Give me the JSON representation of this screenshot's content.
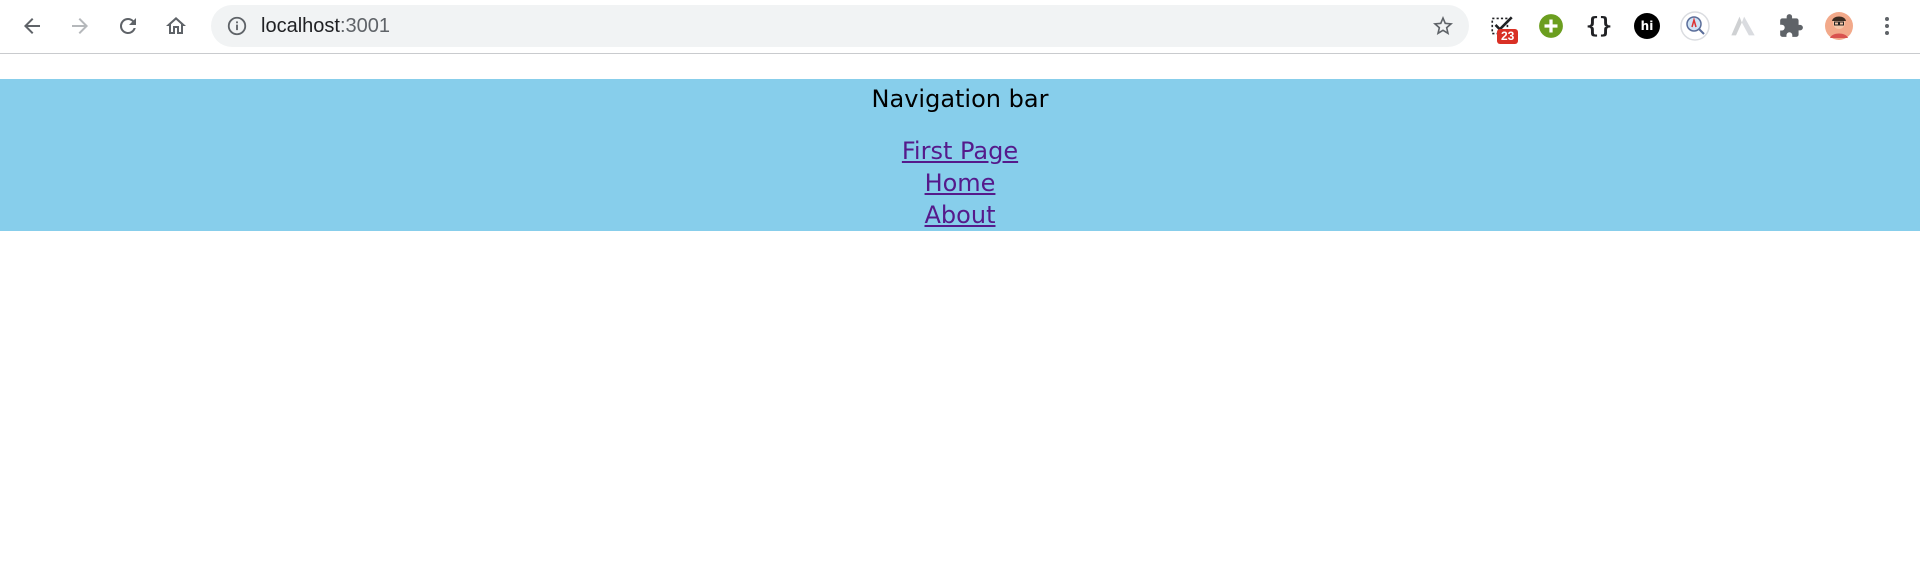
{
  "browser": {
    "address_host": "localhost",
    "address_port": ":3001",
    "extension_badge": "23",
    "extension_hi_label": "hi",
    "extension_braces_label": "{}",
    "icons": [
      "back-icon",
      "forward-icon",
      "reload-icon",
      "home-icon",
      "site-info-icon",
      "bookmark-star-icon",
      "todo-check-icon",
      "green-plus-icon",
      "json-braces-icon",
      "hi-icon",
      "search-lens-icon",
      "gray-triangle-icon",
      "extensions-puzzle-icon",
      "profile-avatar",
      "menu-dots-icon"
    ]
  },
  "page": {
    "navbar": {
      "title": "Navigation bar",
      "links": [
        {
          "label": "First Page"
        },
        {
          "label": "Home"
        },
        {
          "label": "About"
        }
      ]
    }
  },
  "colors": {
    "navbar_bg": "#87ceeb",
    "link_color": "#551a8b",
    "omnibox_bg": "#f1f3f4"
  }
}
